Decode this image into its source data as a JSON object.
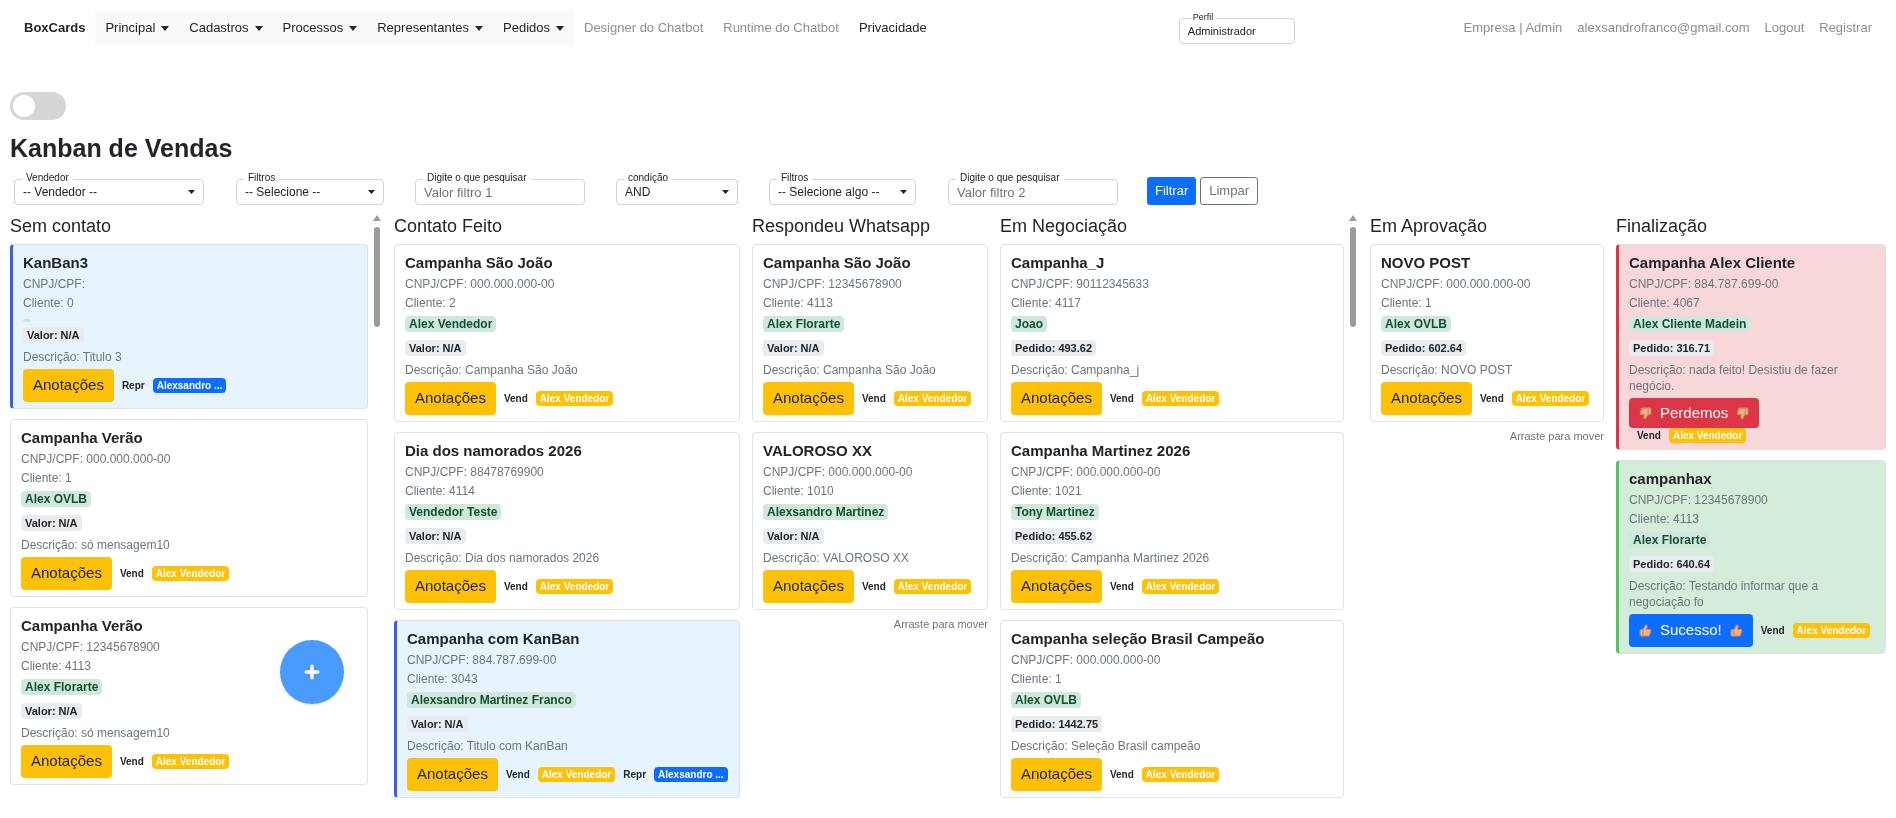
{
  "navbar": {
    "brand": "BoxCards",
    "items": [
      {
        "label": "Principal",
        "dropdown": true,
        "muted": false
      },
      {
        "label": "Cadastros",
        "dropdown": true,
        "muted": false
      },
      {
        "label": "Processos",
        "dropdown": true,
        "muted": false
      },
      {
        "label": "Representantes",
        "dropdown": true,
        "muted": false
      },
      {
        "label": "Pedidos",
        "dropdown": true,
        "muted": false
      },
      {
        "label": "Designer do Chatbot",
        "dropdown": false,
        "muted": true
      },
      {
        "label": "Runtime do Chatbot",
        "dropdown": false,
        "muted": true
      },
      {
        "label": "Privacidade",
        "dropdown": false,
        "muted": false
      }
    ],
    "profile": {
      "label": "Perfil",
      "value": "Administrador"
    },
    "right_links": [
      "Empresa | Admin",
      "alexsandrofranco@gmail.com",
      "Logout",
      "Registrar"
    ]
  },
  "toggle": {
    "on": false
  },
  "title": "Kanban de Vendas",
  "filters": [
    {
      "kind": "select",
      "label": "Vendedor",
      "value": "-- Vendedor --"
    },
    {
      "kind": "select",
      "label": "Filtros",
      "value": "-- Selecione --"
    },
    {
      "kind": "input",
      "label": "Digite o que pesquisar",
      "placeholder": "Valor filtro 1"
    },
    {
      "kind": "select",
      "label": "condição",
      "value": "AND"
    },
    {
      "kind": "select",
      "label": "Filtros",
      "value": "-- Selecione algo --"
    },
    {
      "kind": "input",
      "label": "Digite o que pesquisar",
      "placeholder": "Valor filtro 2"
    }
  ],
  "filter_buttons": [
    {
      "label": "Filtrar",
      "kind": "primary"
    },
    {
      "label": "Limpar",
      "kind": "outline"
    }
  ],
  "columns": [
    {
      "title": "Sem contato",
      "scrollbar": true,
      "cards": [
        {
          "kind": "highlight",
          "title": "KanBan3",
          "cnpj": "CNPJ/CPF:",
          "client": "Cliente: 0",
          "amount": "Valor: N/A",
          "description": "Descrição: Titulo 3",
          "action": {
            "kind": "notes",
            "label": "Anotações"
          },
          "people": [
            {
              "kind": "repr",
              "label": "Repr",
              "name": "Alexsandro ..."
            }
          ]
        },
        {
          "kind": "normal",
          "title": "Campanha Verão",
          "cnpj": "CNPJ/CPF: 000.000.000-00",
          "client": "Cliente: 1",
          "client_tag": "Alex OVLB",
          "amount": "Valor: N/A",
          "description": "Descrição: só mensagem10",
          "action": {
            "kind": "notes",
            "label": "Anotações"
          },
          "people": [
            {
              "kind": "vend",
              "label": "Vend",
              "name": "Alex Vendedor"
            }
          ]
        },
        {
          "kind": "normal",
          "title": "Campanha Verão",
          "cnpj": "CNPJ/CPF: 12345678900",
          "client": "Cliente: 4113",
          "client_tag": "Alex Florarte",
          "amount": "Valor: N/A",
          "description": "Descrição: só mensagem10",
          "action": {
            "kind": "notes",
            "label": "Anotações"
          },
          "people": [
            {
              "kind": "vend",
              "label": "Vend",
              "name": "Alex Vendedor"
            }
          ]
        }
      ]
    },
    {
      "title": "Contato Feito",
      "scrollbar": false,
      "cards": [
        {
          "kind": "normal",
          "title": "Campanha São João",
          "cnpj": "CNPJ/CPF: 000.000.000-00",
          "client": "Cliente: 2",
          "client_tag": "Alex Vendedor",
          "amount": "Valor: N/A",
          "description": "Descrição: Campanha São João",
          "action": {
            "kind": "notes",
            "label": "Anotações"
          },
          "people": [
            {
              "kind": "vend",
              "label": "Vend",
              "name": "Alex Vendedor"
            }
          ]
        },
        {
          "kind": "normal",
          "title": "Dia dos namorados 2026",
          "cnpj": "CNPJ/CPF: 88478769900",
          "client": "Cliente: 4114",
          "client_tag": "Vendedor Teste",
          "amount": "Valor: N/A",
          "description": "Descrição: Dia dos namorados 2026",
          "action": {
            "kind": "notes",
            "label": "Anotações"
          },
          "people": [
            {
              "kind": "vend",
              "label": "Vend",
              "name": "Alex Vendedor"
            }
          ]
        },
        {
          "kind": "highlight",
          "title": "Campanha com KanBan",
          "cnpj": "CNPJ/CPF: 884.787.699-00",
          "client": "Cliente: 3043",
          "client_tag": "Alexsandro Martinez Franco",
          "amount": "Valor: N/A",
          "description": "Descrição: Titulo com KanBan",
          "action": {
            "kind": "notes",
            "label": "Anotações"
          },
          "people": [
            {
              "kind": "vend",
              "label": "Vend",
              "name": "Alex Vendedor"
            },
            {
              "kind": "repr",
              "label": "Repr",
              "name": "Alexsandro ..."
            }
          ]
        }
      ]
    },
    {
      "title": "Respondeu Whatsapp",
      "scrollbar": false,
      "hint": "Arraste para mover",
      "cards": [
        {
          "kind": "normal",
          "title": "Campanha São João",
          "cnpj": "CNPJ/CPF: 12345678900",
          "client": "Cliente: 4113",
          "client_tag": "Alex Florarte",
          "amount": "Valor: N/A",
          "description": "Descrição: Campanha São João",
          "action": {
            "kind": "notes",
            "label": "Anotações"
          },
          "people": [
            {
              "kind": "vend",
              "label": "Vend",
              "name": "Alex Vendedor"
            }
          ]
        },
        {
          "kind": "normal",
          "title": "VALOROSO XX",
          "cnpj": "CNPJ/CPF: 000.000.000-00",
          "client": "Cliente: 1010",
          "client_tag": "Alexsandro Martinez",
          "amount": "Valor: N/A",
          "description": "Descrição: VALOROSO XX",
          "action": {
            "kind": "notes",
            "label": "Anotações"
          },
          "people": [
            {
              "kind": "vend",
              "label": "Vend",
              "name": "Alex Vendedor"
            }
          ]
        }
      ]
    },
    {
      "title": "Em Negociação",
      "scrollbar": true,
      "cards": [
        {
          "kind": "normal",
          "title": "Campanha_J",
          "cnpj": "CNPJ/CPF: 90112345633",
          "client": "Cliente: 4117",
          "client_tag": "Joao",
          "amount": "Pedido: 493.62",
          "description": "Descrição: Campanha_j",
          "action": {
            "kind": "notes",
            "label": "Anotações"
          },
          "people": [
            {
              "kind": "vend",
              "label": "Vend",
              "name": "Alex Vendedor"
            }
          ]
        },
        {
          "kind": "normal",
          "title": "Campanha Martinez 2026",
          "cnpj": "CNPJ/CPF: 000.000.000-00",
          "client": "Cliente: 1021",
          "client_tag": "Tony Martinez",
          "amount": "Pedido: 455.62",
          "description": "Descrição: Campanha Martinez 2026",
          "action": {
            "kind": "notes",
            "label": "Anotações"
          },
          "people": [
            {
              "kind": "vend",
              "label": "Vend",
              "name": "Alex Vendedor"
            }
          ]
        },
        {
          "kind": "normal",
          "title": "Campanha seleção Brasil Campeão",
          "cnpj": "CNPJ/CPF: 000.000.000-00",
          "client": "Cliente: 1",
          "client_tag": "Alex OVLB",
          "amount": "Pedido: 1442.75",
          "description": "Descrição: Seleção Brasil campeão",
          "action": {
            "kind": "notes",
            "label": "Anotações"
          },
          "people": [
            {
              "kind": "vend",
              "label": "Vend",
              "name": "Alex Vendedor"
            }
          ]
        }
      ]
    },
    {
      "title": "Em Aprovação",
      "scrollbar": false,
      "hint": "Arraste para mover",
      "cards": [
        {
          "kind": "normal",
          "title": "NOVO POST",
          "cnpj": "CNPJ/CPF: 000.000.000-00",
          "client": "Cliente: 1",
          "client_tag": "Alex OVLB",
          "amount": "Pedido: 602.64",
          "description": "Descrição: NOVO POST",
          "action": {
            "kind": "notes",
            "label": "Anotações"
          },
          "people": [
            {
              "kind": "vend",
              "label": "Vend",
              "name": "Alex Vendedor"
            }
          ]
        }
      ]
    },
    {
      "title": "Finalização",
      "scrollbar": false,
      "cards": [
        {
          "kind": "lost",
          "title": "Campanha Alex Cliente",
          "cnpj": "CNPJ/CPF: 884.787.699-00",
          "client": "Cliente: 4067",
          "client_tag": "Alex Cliente Madein",
          "amount": "Pedido: 316.71",
          "description": "Descrição: nada feito! Desistiu de fazer negócio.",
          "action": {
            "kind": "lost",
            "label": "Perdemos"
          },
          "people": [
            {
              "kind": "vend",
              "label": "Vend",
              "name": "Alex Vendedor"
            }
          ]
        },
        {
          "kind": "won",
          "title": "campanhax",
          "cnpj": "CNPJ/CPF: 12345678900",
          "client": "Cliente: 4113",
          "client_tag": "Alex Florarte",
          "amount": "Pedido: 640.64",
          "description": "Descrição: Testando informar que a negociação fo",
          "action": {
            "kind": "won",
            "label": "Sucesso!"
          },
          "people": [
            {
              "kind": "vend",
              "label": "Vend",
              "name": "Alex Vendedor"
            }
          ]
        }
      ]
    }
  ]
}
